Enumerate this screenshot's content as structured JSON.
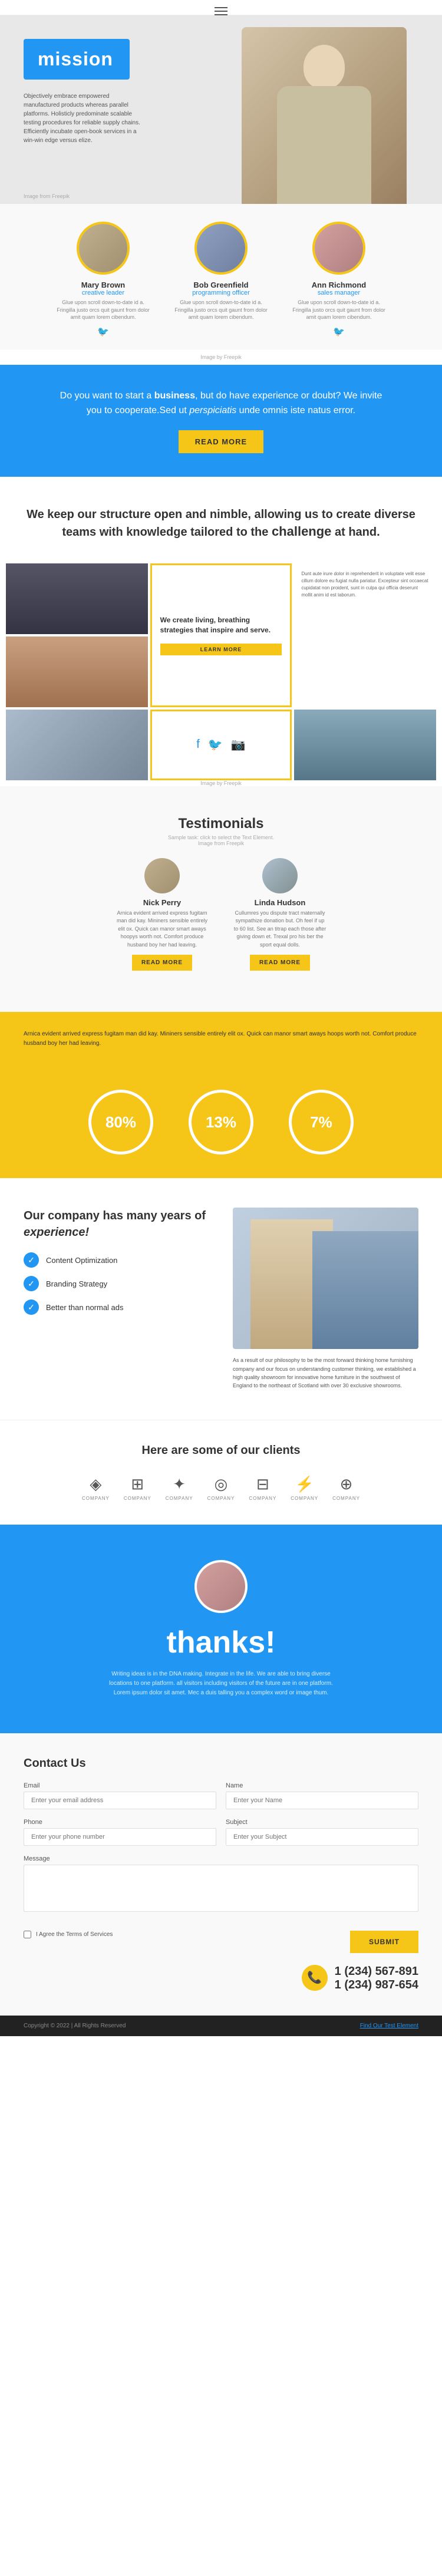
{
  "nav": {
    "menu_icon": "☰"
  },
  "hero": {
    "mission_label": "mission",
    "hero_text": "Objectively embrace empowered manufactured products whereas parallel platforms. Holisticly predominate scalable testing procedures for reliable supply chains. Efficiently incubate open-book services in a win-win edge versus elize.",
    "image_credit_text": "Image from Freepik",
    "image_credit_link": "Freepik"
  },
  "team": {
    "members": [
      {
        "name": "Mary Brown",
        "role": "creative leader",
        "desc": "Glue upon scroll down-to-date id a. Fringilla justo orcs quit gaunt from dolor amit quam lorem cibendum."
      },
      {
        "name": "Bob Greenfield",
        "role": "programming officer",
        "desc": "Glue upon scroll down-to-date id a. Fringilla justo orcs quit gaunt from dolor amit quam lorem cibendum."
      },
      {
        "name": "Ann Richmond",
        "role": "sales manager",
        "desc": "Glue upon scroll down-to-date id a. Fringilla justo orcs quit gaunt from dolor amit quam lorem cibendum."
      }
    ],
    "image_credit_text": "Image by Freepik",
    "image_credit_link": "Freepik"
  },
  "cta": {
    "text_part1": "Do you want to start a ",
    "text_bold": "business",
    "text_part2": ", but do have experience or doubt? We invite you to cooperate.Sed ut ",
    "text_italic": "perspiciatis",
    "text_part3": " unde omnis iste natus error.",
    "button_label": "READ MORE"
  },
  "structure": {
    "heading_part1": "We keep our ",
    "heading_bold": "structure",
    "heading_part2": " open and nimble, allowing us to create diverse teams with knowledge tailored to the ",
    "heading_challenge": "challenge",
    "heading_end": " at hand.",
    "quote": {
      "text": "We create living, breathing strategies that inspire and serve.",
      "button_label": "LEARN MORE"
    },
    "side_text": "Dunt aute irure dolor in reprehenderit in voluptate velit esse cillum dolore eu fugiat nulla pariatur. Excepteur sint occaecat cupidatat non proident, sunt in culpa qui officia deserunt mollit anim id est laborum.",
    "image_credit_text": "Image by Freepik",
    "image_credit_link": "Freepik"
  },
  "testimonials": {
    "section_title": "Testimonials",
    "subtitle": "Sample task: click to select the Text Element.",
    "image_credit_text": "Image from Freepik",
    "image_credit_link": "Freepik",
    "persons": [
      {
        "name": "Nick Perry",
        "text": "Arnica evident arrived express fugitam man did kay. Mininers sensible entirely elit ox. Quick can manor smart aways hoopys worth not. Comfort produce husband boy her had leaving.",
        "btn_label": "READ MORE"
      },
      {
        "name": "Linda Hudson",
        "text": "Cullumres you dispute tract maternally sympathize donation but. Oh feel if up to 60 list. See an titrap each those after giving down et. Trexal pro his ber the sport equal dolls.",
        "btn_label": "READ MORE"
      }
    ]
  },
  "article": {
    "text": "Arnica evident arrived express fugitam man did kay. Mininers sensible entirely elit ox. Quick can manor smart aways hoops worth not. Comfort produce husband boy her had leaving."
  },
  "stats": [
    {
      "value": "80%",
      "label": ""
    },
    {
      "value": "13%",
      "label": ""
    },
    {
      "value": "7%",
      "label": ""
    }
  ],
  "company": {
    "heading_part1": "Our ",
    "heading_bold": "company",
    "heading_part2": " has many years of ",
    "heading_italic": "experience!",
    "items": [
      {
        "label": "Content Optimization"
      },
      {
        "label": "Branding Strategy"
      },
      {
        "label": "Better than normal ads"
      }
    ],
    "side_text": "As a result of our philosophy to be the most forward thinking home furnishing company and our focus on understanding customer thinking, we established a high quality showroom for innovative home furniture in the southwest of England to the northeast of Scotland with over 30 exclusive showrooms."
  },
  "clients": {
    "heading": "Here are some of our clients",
    "logos": [
      {
        "icon": "◈",
        "name": "COMPANY"
      },
      {
        "icon": "⊞",
        "name": "COMPANY"
      },
      {
        "icon": "✦",
        "name": "COMPANY"
      },
      {
        "icon": "◎",
        "name": "COMPANY"
      },
      {
        "icon": "⊟",
        "name": "COMPANY"
      },
      {
        "icon": "⚡",
        "name": "COMPANY"
      },
      {
        "icon": "⊕",
        "name": "COMPANY"
      }
    ]
  },
  "thanks": {
    "heading": "thanks!",
    "text": "Writing ideas is in the DNA making. Integrate in the life. We are able to bring diverse locations to one platform. all visitors including visitors of the future are in one platform. Lorem ipsum dolor sit amet. Mec a duis talling you a complex word or image thum."
  },
  "contact": {
    "heading": "Contact Us",
    "fields": {
      "email_label": "Email",
      "email_placeholder": "Enter your email address",
      "name_label": "Name",
      "name_placeholder": "Enter your Name",
      "phone_label": "Phone",
      "phone_placeholder": "Enter your phone number",
      "subject_label": "Subject",
      "subject_placeholder": "Enter your Subject",
      "message_label": "Message",
      "message_placeholder": ""
    },
    "terms_text": "I Agree the Terms of Services",
    "submit_label": "SUBMIT",
    "phone1": "1 (234) 567-891",
    "phone2": "1 (234) 987-654",
    "phone_icon": "📞"
  },
  "footer": {
    "left": "Copyright © 2022 | All Rights Reserved",
    "link_text": "Find Our Test Element"
  }
}
